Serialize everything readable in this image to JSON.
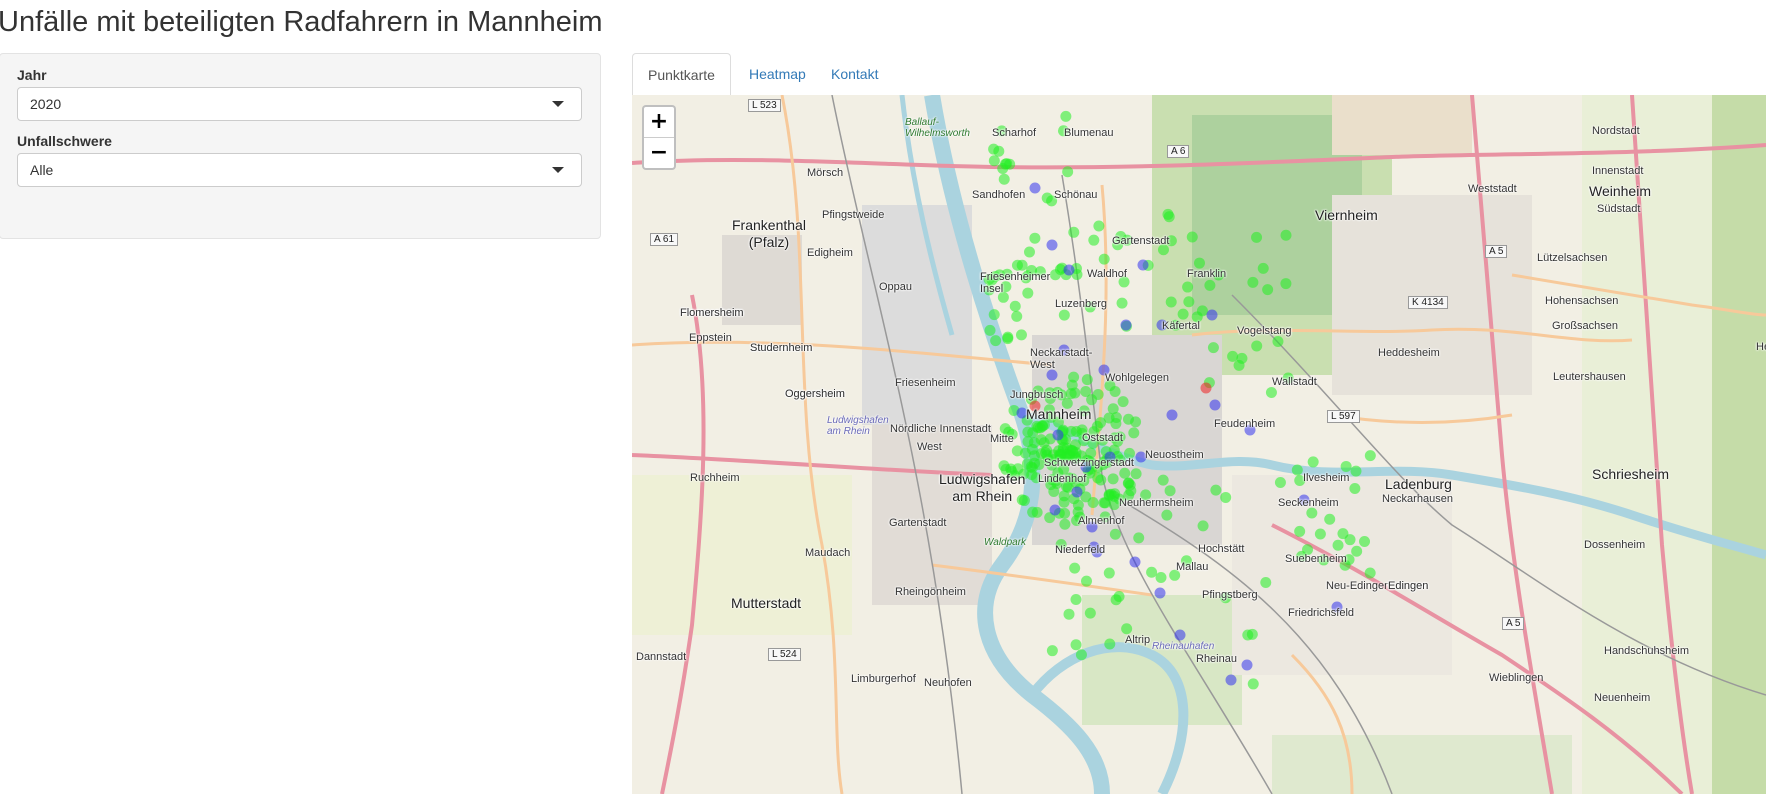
{
  "page": {
    "title": "Unfälle mit beteiligten Radfahrern in Mannheim"
  },
  "sidebar": {
    "year": {
      "label": "Jahr",
      "value": "2020"
    },
    "severity": {
      "label": "Unfallschwere",
      "value": "Alle"
    }
  },
  "tabs": [
    {
      "label": "Punktkarte",
      "active": true
    },
    {
      "label": "Heatmap",
      "active": false
    },
    {
      "label": "Kontakt",
      "active": false
    }
  ],
  "map": {
    "zoom_in": "+",
    "zoom_out": "−",
    "places": [
      "Scharhof",
      "Blumenau",
      "Sandhofen",
      "Schönau",
      "Mörsch",
      "Pfingstweide",
      "Frankenthal\n(Pfalz)",
      "Edigheim",
      "Oppau",
      "Gartenstadt",
      "Waldhof",
      "Franklin",
      "Friesenheimer\nInsel",
      "Luzenberg",
      "Käfertal",
      "Vogelstang",
      "Flomersheim",
      "Eppstein",
      "Studernheim",
      "Neckarstadt-\nWest",
      "Wohlgelegen",
      "Wallstadt",
      "Friesenheim",
      "Oggersheim",
      "Jungbusch",
      "Mannheim",
      "Feudenheim",
      "Nördliche Innenstadt",
      "Mitte",
      "West",
      "Oststadt",
      "Neuostheim",
      "Schwetzingerstadt",
      "Ruchheim",
      "Ludwigshafen\nam Rhein",
      "Lindenhof",
      "Neuhermsheim",
      "Ilvesheim",
      "Seckenheim",
      "Ladenburg",
      "Neckarhausen",
      "Gartenstadt",
      "Almenhof",
      "Maudach",
      "Niederfeld",
      "Hochstätt",
      "Suebenheim",
      "Mallau",
      "Rheingönheim",
      "Mutterstadt",
      "Pfingstberg",
      "Neu-Edingen",
      "Edingen",
      "Friedrichsfeld",
      "Altrip",
      "Rheinau",
      "Dannstadt",
      "Limburgerhof",
      "Neuhofen",
      "Viernheim",
      "Weststadt",
      "Weinheim",
      "Nordstadt",
      "Innenstadt",
      "Südstadt",
      "Lützelsachsen",
      "Hohensachsen",
      "Großsachsen",
      "Heddesheim",
      "Leutershausen",
      "Schriesheim",
      "Dossenheim",
      "Wieblingen",
      "Handschuhsheim",
      "Neuenheim",
      "Heilb",
      "Rheinauhafen",
      "Waldpark",
      "Ludwigshafen\nam Rhein",
      "Ballauf-\nWilhelmsworth",
      "Flomersheim",
      "Oggersheim",
      "Studernheim",
      "Edingen"
    ],
    "road_labels": [
      "L 523",
      "A 6",
      "A 61",
      "K 4134",
      "A 5",
      "L 597",
      "L 524",
      "A 5"
    ],
    "legend_colors": {
      "minor": "#22ee22",
      "serious": "#3333ee",
      "fatal": "#ee2222"
    }
  }
}
